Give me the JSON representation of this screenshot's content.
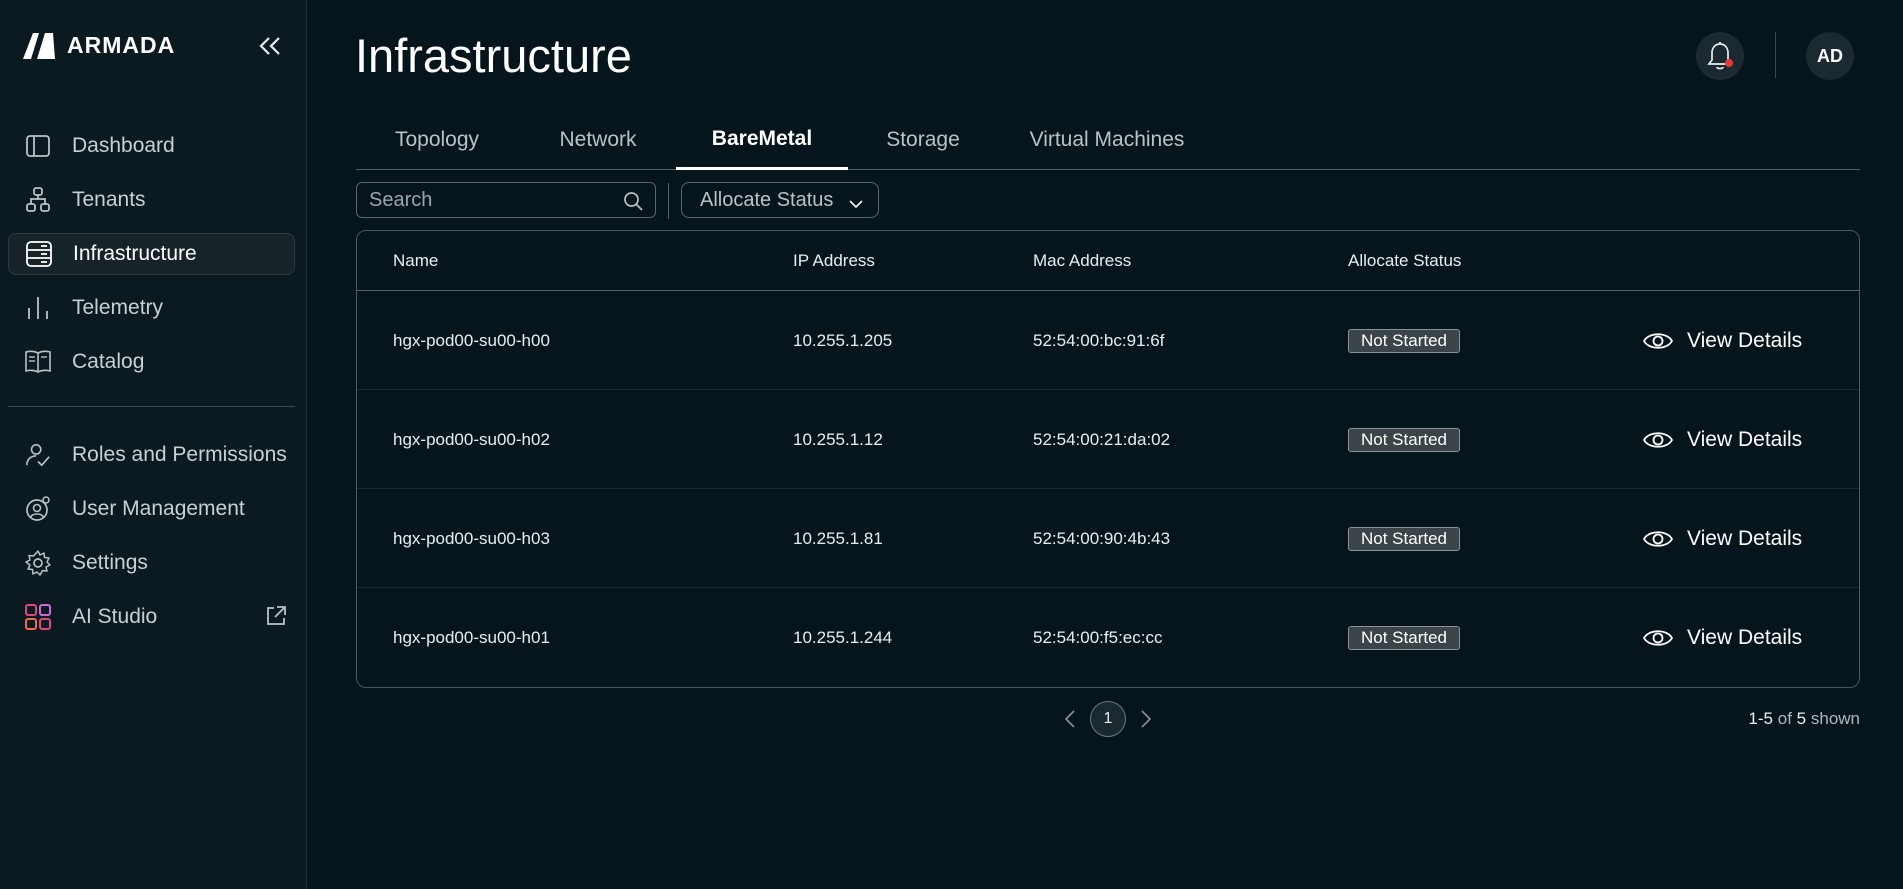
{
  "app": {
    "logo_text": "ARMADA"
  },
  "sidebar": {
    "items": [
      {
        "label": "Dashboard",
        "icon": "panel-icon"
      },
      {
        "label": "Tenants",
        "icon": "hierarchy-icon"
      },
      {
        "label": "Infrastructure",
        "icon": "server-icon",
        "active": true
      },
      {
        "label": "Telemetry",
        "icon": "bar-chart-icon"
      },
      {
        "label": "Catalog",
        "icon": "book-icon"
      }
    ],
    "items_secondary": [
      {
        "label": "Roles and Permissions",
        "icon": "users-check-icon"
      },
      {
        "label": "User Management",
        "icon": "user-gear-icon"
      },
      {
        "label": "Settings",
        "icon": "gear-icon"
      },
      {
        "label": "AI Studio",
        "icon": "grid-icon"
      }
    ]
  },
  "header": {
    "title": "Infrastructure",
    "avatar_initials": "AD"
  },
  "tabs": [
    {
      "label": "Topology"
    },
    {
      "label": "Network"
    },
    {
      "label": "BareMetal",
      "active": true
    },
    {
      "label": "Storage"
    },
    {
      "label": "Virtual Machines"
    }
  ],
  "search": {
    "placeholder": "Search",
    "value": ""
  },
  "filter": {
    "label": "Allocate Status"
  },
  "table": {
    "columns": [
      "Name",
      "IP Address",
      "Mac Address",
      "Allocate Status"
    ],
    "action_label": "View Details",
    "rows": [
      {
        "name": "hgx-pod00-su00-h00",
        "ip": "10.255.1.205",
        "mac": "52:54:00:bc:91:6f",
        "status": "Not Started"
      },
      {
        "name": "hgx-pod00-su00-h02",
        "ip": "10.255.1.12",
        "mac": "52:54:00:21:da:02",
        "status": "Not Started"
      },
      {
        "name": "hgx-pod00-su00-h03",
        "ip": "10.255.1.81",
        "mac": "52:54:00:90:4b:43",
        "status": "Not Started"
      },
      {
        "name": "hgx-pod00-su00-h01",
        "ip": "10.255.1.244",
        "mac": "52:54:00:f5:ec:cc",
        "status": "Not Started"
      }
    ]
  },
  "pagination": {
    "current_page": "1",
    "range": "1-5",
    "of_word": "of",
    "total": "5",
    "shown_word": "shown"
  },
  "colors": {
    "background": "#06151b",
    "sidebar": "#0b1a20",
    "notification_dot": "#e53935"
  }
}
